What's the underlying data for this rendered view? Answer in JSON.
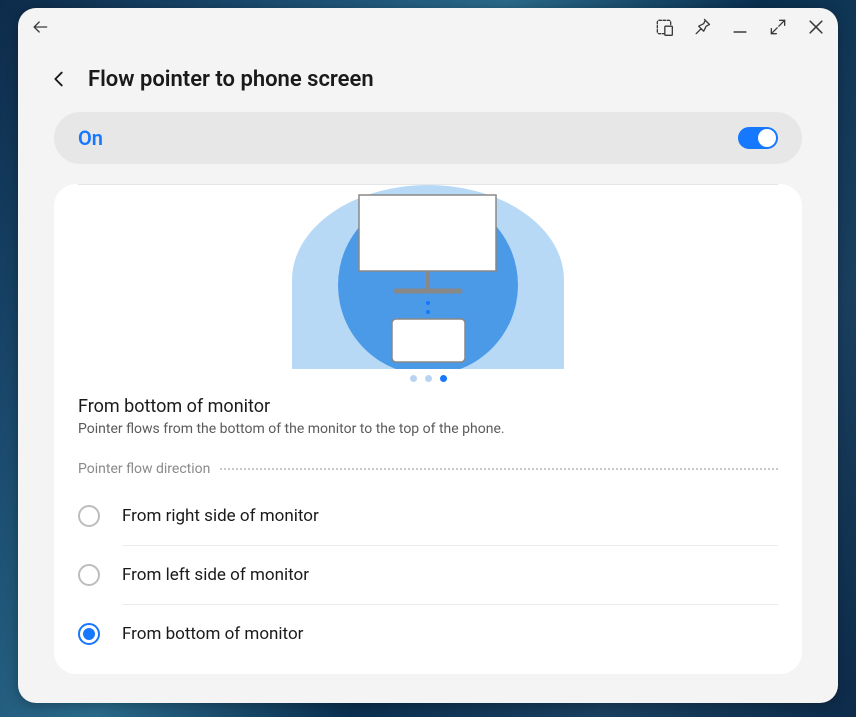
{
  "header": {
    "title": "Flow pointer to phone screen"
  },
  "toggle": {
    "label": "On",
    "enabled": true
  },
  "illustration": {
    "pager_index": 2,
    "pager_count": 3
  },
  "caption": {
    "title": "From bottom of monitor",
    "subtitle": "Pointer flows from the bottom of the monitor to the top of the phone."
  },
  "section": {
    "label": "Pointer flow direction"
  },
  "options": [
    {
      "label": "From right side of monitor",
      "selected": false
    },
    {
      "label": "From left side of monitor",
      "selected": false
    },
    {
      "label": "From bottom of monitor",
      "selected": true
    }
  ],
  "colors": {
    "accent": "#1677ff"
  }
}
